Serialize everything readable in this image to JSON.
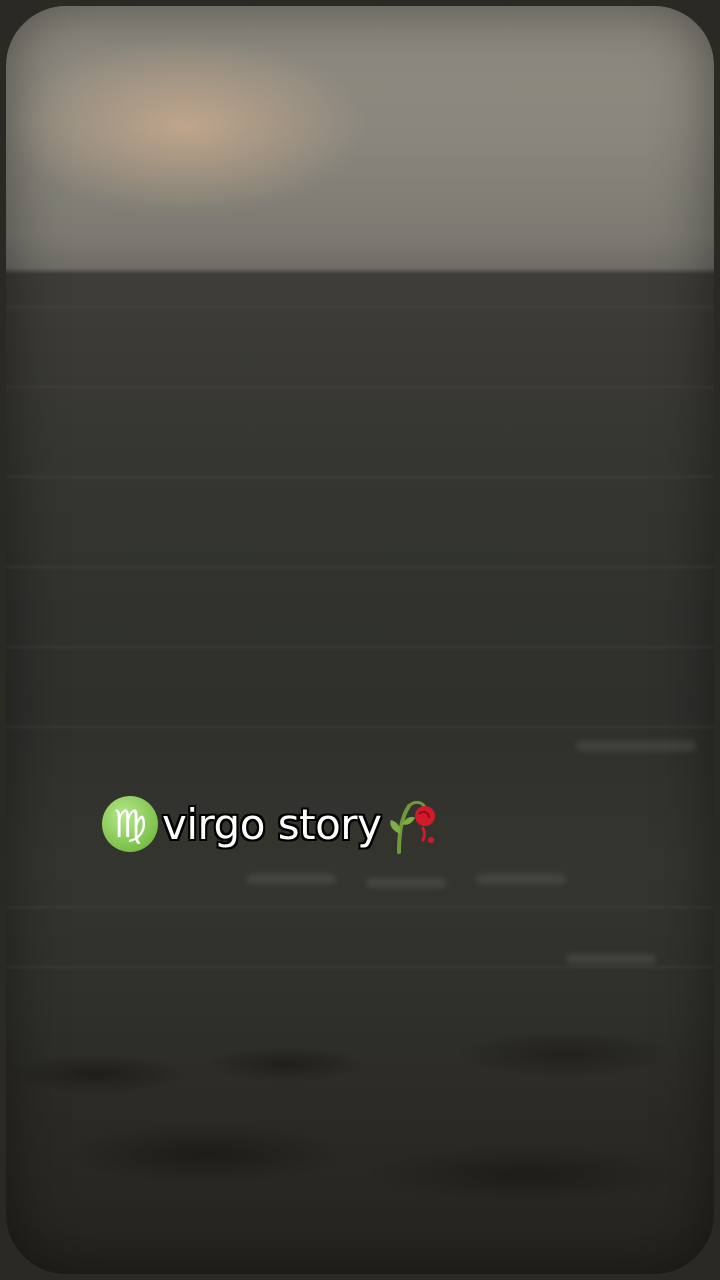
{
  "caption": {
    "text": "virgo story",
    "leading_icon": "virgo-zodiac-icon",
    "trailing_icon": "wilted-rose-icon"
  },
  "colors": {
    "sky": "#8d8a80",
    "sea": "#33342f",
    "virgo_badge": "#7cc04a",
    "rose": "#d11a2a"
  }
}
